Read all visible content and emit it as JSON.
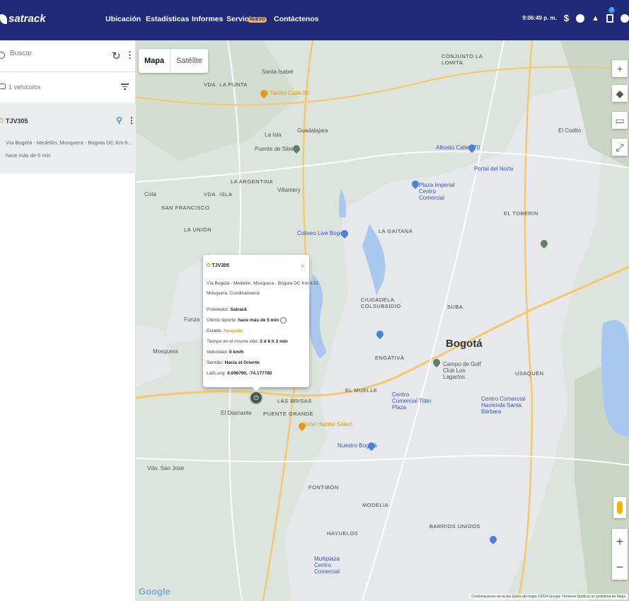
{
  "topbar": {
    "logo": "satrack",
    "nav": [
      "Ubicación",
      "Estadísticas",
      "Informes",
      "Servicios",
      "Contáctenos"
    ],
    "nuevo_badge": "NUEVO",
    "time": "9:06:49 p. m.",
    "notification_count": "2"
  },
  "sidebar": {
    "search_placeholder": "Buscar",
    "vehicles_label": "1 vehículos",
    "vehicle": {
      "plate": "TJV305",
      "address": "Vía Bogotá - Medellín, Mosquera - Bogota DC Km 6.51 Mosquera, ...",
      "last_seen": "hace más de 5 min"
    }
  },
  "map": {
    "toggle": [
      "Mapa",
      "Satélite"
    ],
    "attribution": "Combinaciones de teclas   Datos del mapa ©2024 Google   Términos   Notificar un problema de Maps",
    "labels": {
      "bogota": "Bogotá",
      "suba": "SUBA",
      "engativa": "ENGATIVÁ",
      "fontibon": "FONTIBÓN",
      "usaquen": "USAQUÉN",
      "barrios_unidos": "BARRIOS UNIDOS",
      "la_gaitana": "LA GAITANA",
      "el_toberin": "EL TOBERIN",
      "ciudadela": "CIUDADELA COLSUBSIDIO",
      "mosquera": "Mosquera",
      "funza": "Funza",
      "cota": "Cota",
      "el_diamante": "El Diamante",
      "puente_grande": "PUENTE GRANDE",
      "las_brisas": "LAS BRISAS",
      "la_isla": "La Isla",
      "guadalajara": "Guadalajara",
      "villamery": "Villamery",
      "la_argentina": "LA ARGENTINA",
      "san_francisco": "SAN FRANCISCO",
      "la_union": "LA UNIÓN",
      "vda_san_jose": "Vda. San José",
      "santa_isabel": "Santa Isabel",
      "vda_la_punta": "VDA. LA PUNTA",
      "el_tambo": "El Tambo Calle 80",
      "la_lomita": "CONJUNTO LA LOMITA",
      "puente_siberia": "Puente de Siberia",
      "coliseo": "Coliseo Live Bogotá",
      "el_codito": "El Codito",
      "nuestro_bogota": "Nuestro Bogotá",
      "titan": "Centro Comercial Titán Plaza",
      "unicentro": "Centro Comercial Hacienda Santa Bárbara",
      "hotel": "Hotel Habitel Select",
      "el_muelle": "EL MUELLE",
      "hayuelos": "HAYUELOS",
      "modelia": "MODELIA",
      "multiplaza": "Multiplaza Centro Comercial",
      "campo_golf": "Campo de Golf Club Los Lagartos",
      "plaza_imperial": "Plaza Imperial Centro Comercial",
      "portal_norte": "Portal del Norte",
      "alkosto_170": "Alkosto Calle 170",
      "vda_isla": "VDA. ISLA"
    }
  },
  "popup": {
    "plate": "TJV305",
    "address1": "Vía Bogotá - Medellín, Mosquera - Bogota DC Km 6.51",
    "address2": "Mosquera, Cundinamarca",
    "proveedor_label": "Proveedor:",
    "proveedor": "Satrack",
    "reporte_label": "Último reporte:",
    "reporte": "hace más de 5 min",
    "estado_label": "Estado:",
    "estado": "Apagado",
    "tiempo_label": "Tiempo en el mismo sitio:",
    "tiempo": "2 d 6 h 3 min",
    "velocidad_label": "Velocidad:",
    "velocidad": "0 km/h",
    "sentido_label": "Sentido:",
    "sentido": "Hacia el Oriente",
    "latlong_label": "Lat/Long:",
    "latlong": "4.696790, -74.177780"
  },
  "colors": {
    "brand": "#1f2a78",
    "accent": "#e3a21a",
    "link": "#1f6fd1"
  }
}
